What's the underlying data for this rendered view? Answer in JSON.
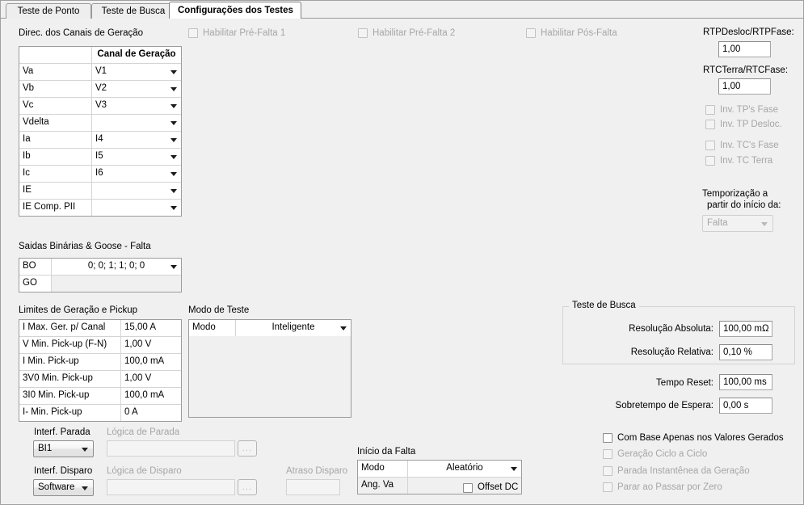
{
  "tabs": [
    {
      "label": "Teste de Ponto",
      "active": false
    },
    {
      "label": "Teste de Busca",
      "active": false
    },
    {
      "label": "Configurações dos Testes",
      "active": true
    }
  ],
  "gen_channels": {
    "title": "Direc. dos Canais de Geração",
    "col_header": "Canal de Geração",
    "rows": [
      {
        "label": "Va",
        "value": "V1"
      },
      {
        "label": "Vb",
        "value": "V2"
      },
      {
        "label": "Vc",
        "value": "V3"
      },
      {
        "label": "Vdelta",
        "value": ""
      },
      {
        "label": "Ia",
        "value": "I4"
      },
      {
        "label": "Ib",
        "value": "I5"
      },
      {
        "label": "Ic",
        "value": "I6"
      },
      {
        "label": "IE",
        "value": ""
      },
      {
        "label": "IE Comp. PII",
        "value": ""
      }
    ]
  },
  "prefault_checks": [
    {
      "label": "Habilitar Pré-Falta 1",
      "checked": false
    },
    {
      "label": "Habilitar Pré-Falta 2",
      "checked": false
    },
    {
      "label": "Habilitar Pós-Falta",
      "checked": false
    }
  ],
  "ratios": {
    "rtp_label": "RTPDesloc/RTPFase:",
    "rtp_value": "1,00",
    "rtc_label": "RTCTerra/RTCFase:",
    "rtc_value": "1,00"
  },
  "inversions": [
    {
      "label": "Inv. TP's Fase",
      "checked": false
    },
    {
      "label": "Inv. TP Desloc.",
      "checked": false
    },
    {
      "label": "Inv. TC's Fase",
      "checked": false
    },
    {
      "label": "Inv. TC Terra",
      "checked": false
    }
  ],
  "timing": {
    "label_line1": "Temporização a",
    "label_line2": "partir do início da:",
    "value": "Falta",
    "disabled": true
  },
  "binary_outputs": {
    "title": "Saidas Binárias & Goose - Falta",
    "rows": [
      {
        "label": "BO",
        "value": "0; 0; 1; 1; 0; 0",
        "has_combo": true
      },
      {
        "label": "GO",
        "value": "",
        "has_combo": false
      }
    ]
  },
  "limits": {
    "title": "Limites de Geração e Pickup",
    "rows": [
      {
        "label": "I Max. Ger. p/ Canal",
        "value": "15,00 A"
      },
      {
        "label": "V Min. Pick-up (F-N)",
        "value": "1,00 V"
      },
      {
        "label": "I Min. Pick-up",
        "value": "100,0 mA"
      },
      {
        "label": "3V0 Min. Pick-up",
        "value": "1,00 V"
      },
      {
        "label": "3I0 Min. Pick-up",
        "value": "100,0 mA"
      },
      {
        "label": "I- Min. Pick-up",
        "value": "0 A"
      }
    ]
  },
  "test_mode": {
    "title": "Modo de Teste",
    "row_label": "Modo",
    "value": "Inteligente"
  },
  "search_test": {
    "title": "Teste de Busca",
    "abs_label": "Resolução Absoluta:",
    "abs_value": "100,00 mΩ",
    "rel_label": "Resolução Relativa:",
    "rel_value": "0,10 %"
  },
  "reset_times": {
    "reset_label": "Tempo Reset:",
    "reset_value": "100,00 ms",
    "wait_label": "Sobretempo de Espera:",
    "wait_value": "0,00 s"
  },
  "interfaces": {
    "stop_label": "Interf. Parada",
    "stop_value": "BI1",
    "stop_logic_label": "Lógica de Parada",
    "stop_logic_value": "",
    "trip_label": "Interf. Disparo",
    "trip_value": "Software",
    "trip_logic_label": "Lógica de Disparo",
    "trip_logic_value": "",
    "browse_label": "...",
    "delay_label": "Atraso Disparo",
    "delay_value": ""
  },
  "fault_start": {
    "title": "Início da Falta",
    "mode_label": "Modo",
    "mode_value": "Aleatório",
    "ang_label": "Ang. Va",
    "ang_value": "",
    "offset_label": "Offset DC",
    "offset_checked": false
  },
  "bottom_options": [
    {
      "label": "Com Base Apenas nos Valores Gerados",
      "checked": false,
      "disabled": false
    },
    {
      "label": "Geração Ciclo a Ciclo",
      "checked": false,
      "disabled": true
    },
    {
      "label": "Parada Instantênea da Geração",
      "checked": false,
      "disabled": true
    },
    {
      "label": "Parar ao Passar por Zero",
      "checked": false,
      "disabled": true
    }
  ]
}
